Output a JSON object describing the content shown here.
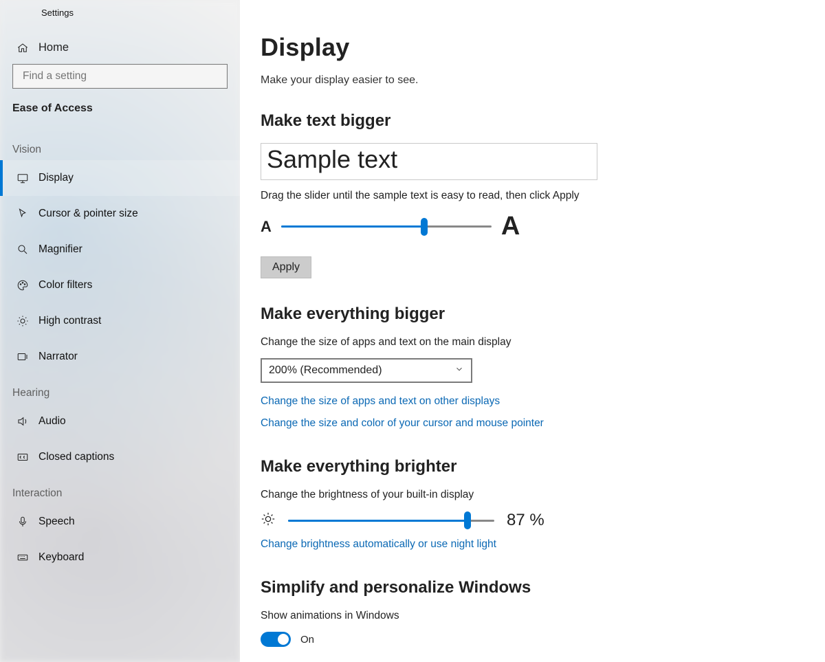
{
  "title": "Settings",
  "home_label": "Home",
  "search_placeholder": "Find a setting",
  "section_label": "Ease of Access",
  "groups": {
    "vision": "Vision",
    "hearing": "Hearing",
    "interaction": "Interaction"
  },
  "nav": {
    "display": "Display",
    "cursor": "Cursor & pointer size",
    "magnifier": "Magnifier",
    "color_filters": "Color filters",
    "high_contrast": "High contrast",
    "narrator": "Narrator",
    "audio": "Audio",
    "closed_captions": "Closed captions",
    "speech": "Speech",
    "keyboard": "Keyboard"
  },
  "page": {
    "title": "Display",
    "subtitle": "Make your display easier to see.",
    "text_bigger": {
      "heading": "Make text bigger",
      "sample": "Sample text",
      "help": "Drag the slider until the sample text is easy to read, then click Apply",
      "small_a": "A",
      "big_a": "A",
      "slider_percent": 68,
      "apply": "Apply"
    },
    "everything_bigger": {
      "heading": "Make everything bigger",
      "desc": "Change the size of apps and text on the main display",
      "selected": "200% (Recommended)",
      "link1": "Change the size of apps and text on other displays",
      "link2": "Change the size and color of your cursor and mouse pointer"
    },
    "brighter": {
      "heading": "Make everything brighter",
      "desc": "Change the brightness of your built-in display",
      "slider_percent": 87,
      "pct_label": "87 %",
      "link": "Change brightness automatically or use night light"
    },
    "simplify": {
      "heading": "Simplify and personalize Windows",
      "anim_label": "Show animations in Windows",
      "anim_state": "On"
    }
  }
}
